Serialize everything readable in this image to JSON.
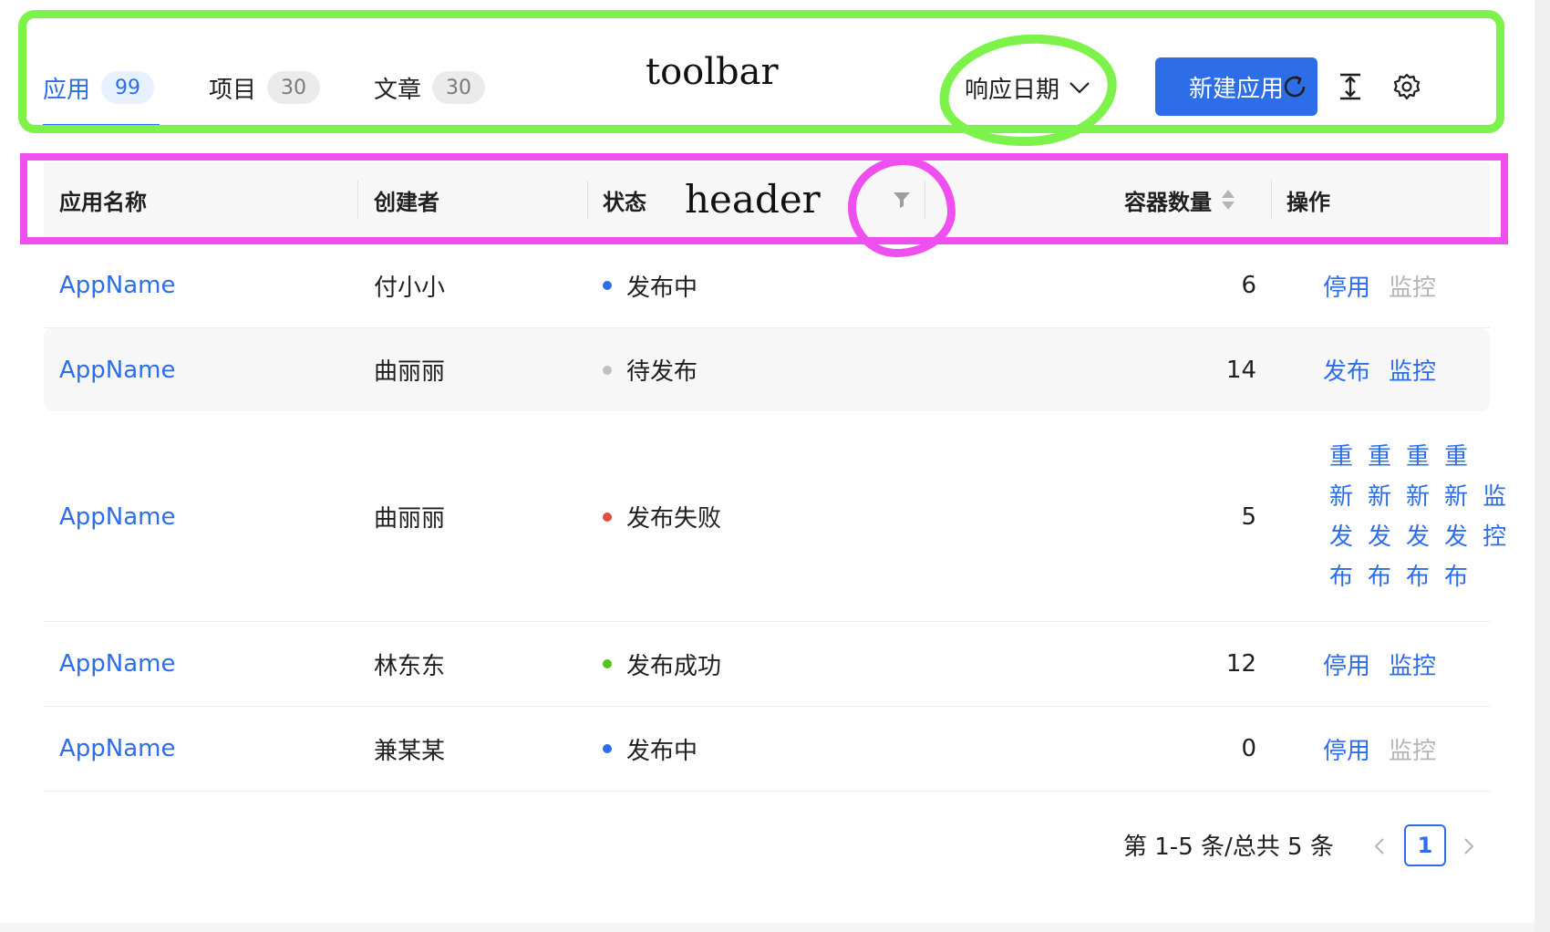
{
  "tabs": [
    {
      "label": "应用",
      "count": "99"
    },
    {
      "label": "项目",
      "count": "30"
    },
    {
      "label": "文章",
      "count": "30"
    }
  ],
  "toolbar": {
    "date_select": "响应日期",
    "new_button": "新建应用",
    "icons": [
      "reload-icon",
      "column-height-icon",
      "setting-icon"
    ]
  },
  "annotations": {
    "toolbar_label": "toolbar",
    "header_label": "header"
  },
  "table": {
    "columns": [
      "应用名称",
      "创建者",
      "状态",
      "容器数量",
      "操作"
    ],
    "rows": [
      {
        "name": "AppName",
        "creator": "付小小",
        "status": "发布中",
        "status_color": "#2d6ee8",
        "containers": "6",
        "actions": [
          "停用",
          "监控"
        ]
      },
      {
        "name": "AppName",
        "creator": "曲丽丽",
        "status": "待发布",
        "status_color": "#bfbfbf",
        "containers": "14",
        "actions": [
          "发布",
          "监控"
        ]
      },
      {
        "name": "AppName",
        "creator": "曲丽丽",
        "status": "发布失败",
        "status_color": "#e84a3f",
        "containers": "5",
        "actions": [
          "重新发布",
          "重新发布",
          "重新发布",
          "重新发布",
          "监控"
        ]
      },
      {
        "name": "AppName",
        "creator": "林东东",
        "status": "发布成功",
        "status_color": "#52c41a",
        "containers": "12",
        "actions": [
          "停用",
          "监控"
        ]
      },
      {
        "name": "AppName",
        "creator": "兼某某",
        "status": "发布中",
        "status_color": "#2d6ee8",
        "containers": "0",
        "actions": [
          "停用",
          "监控"
        ]
      }
    ]
  },
  "pagination": {
    "summary": "第 1-5 条/总共 5 条",
    "current_page": "1",
    "prev": "<",
    "next": ">"
  },
  "colors": {
    "primary": "#2d6ee8",
    "annotation_green": "#7cf24a",
    "annotation_pink": "#f04ff0"
  }
}
